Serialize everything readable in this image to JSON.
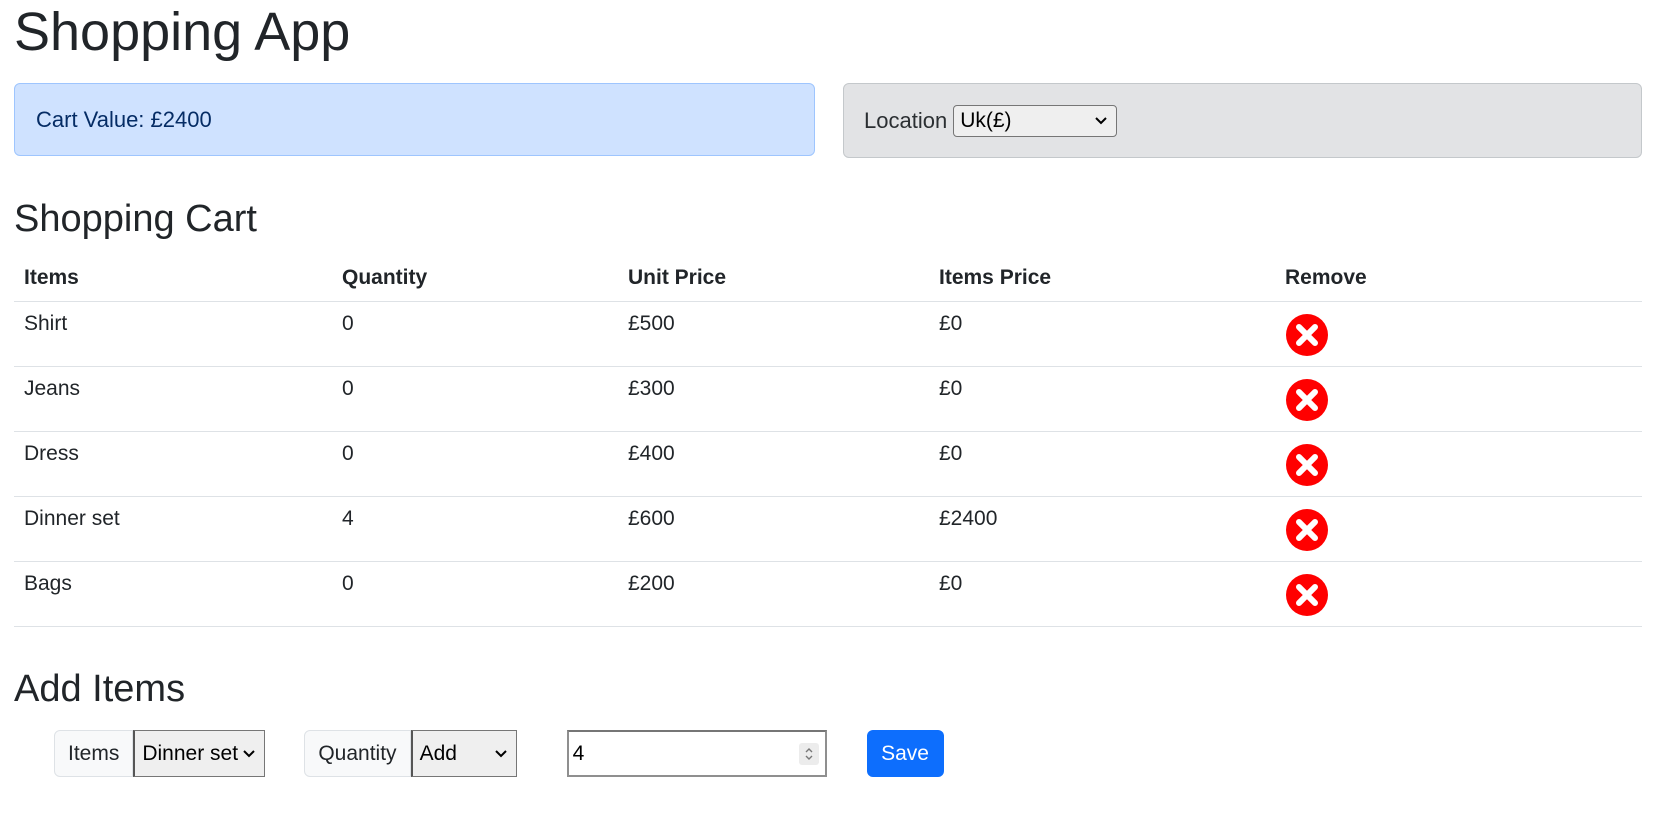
{
  "app": {
    "title": "Shopping App"
  },
  "cart_value": {
    "label": "Cart Value: ",
    "amount": "£2400"
  },
  "location": {
    "label": "Location",
    "selected": "Uk(£)"
  },
  "shopping_cart": {
    "title": "Shopping Cart",
    "headers": [
      "Items",
      "Quantity",
      "Unit Price",
      "Items Price",
      "Remove"
    ],
    "rows": [
      {
        "item": "Shirt",
        "quantity": "0",
        "unit_price": "£500",
        "items_price": "£0"
      },
      {
        "item": "Jeans",
        "quantity": "0",
        "unit_price": "£300",
        "items_price": "£0"
      },
      {
        "item": "Dress",
        "quantity": "0",
        "unit_price": "£400",
        "items_price": "£0"
      },
      {
        "item": "Dinner set",
        "quantity": "4",
        "unit_price": "£600",
        "items_price": "£2400"
      },
      {
        "item": "Bags",
        "quantity": "0",
        "unit_price": "£200",
        "items_price": "£0"
      }
    ],
    "remove_icon": "remove-circle-x-icon",
    "remove_color": "#ff0000"
  },
  "add_items": {
    "title": "Add Items",
    "items_label": "Items",
    "items_selected": "Dinner set",
    "quantity_label": "Quantity",
    "action_selected": "Add",
    "quantity_value": "4",
    "save_label": "Save"
  },
  "colors": {
    "cart_value_bg": "#cfe2ff",
    "location_bg": "#e2e3e5",
    "save_button": "#0d6efd"
  }
}
